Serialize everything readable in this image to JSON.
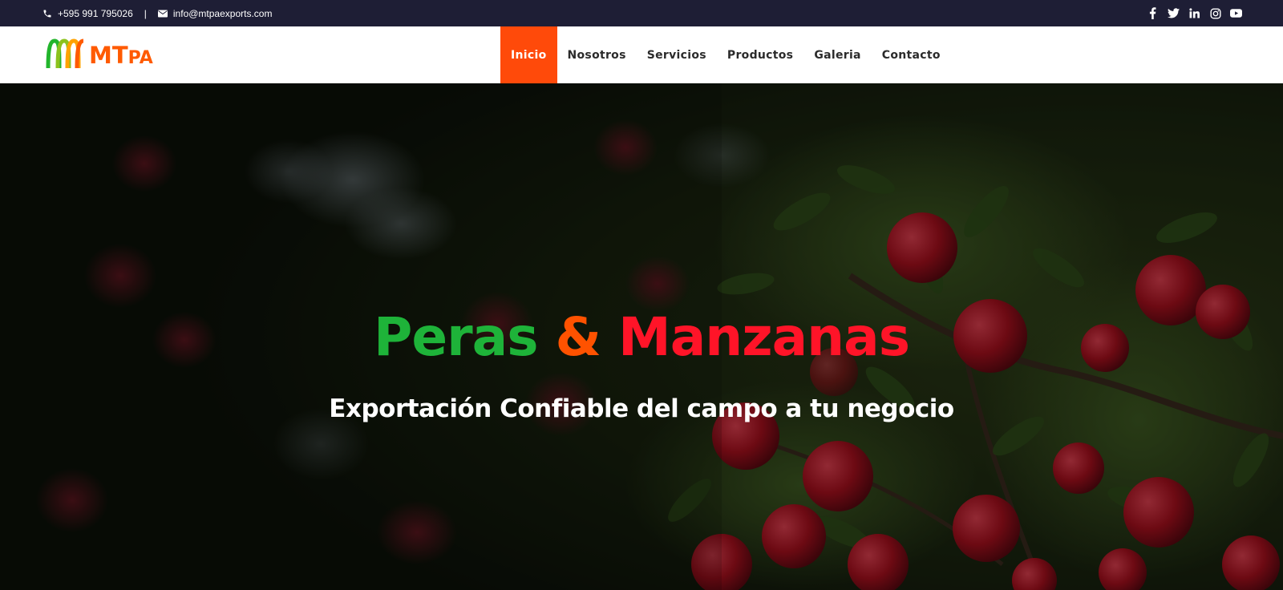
{
  "topbar": {
    "phone": "+595 991 795026",
    "separator": "|",
    "email": "info@mtpaexports.com",
    "social": [
      "facebook-icon",
      "twitter-icon",
      "linkedin-icon",
      "instagram-icon",
      "youtube-icon"
    ]
  },
  "logo": {
    "main": "MT",
    "small": "PA"
  },
  "nav": {
    "items": [
      {
        "label": "Inicio",
        "active": true
      },
      {
        "label": "Nosotros"
      },
      {
        "label": "Servicios"
      },
      {
        "label": "Productos"
      },
      {
        "label": "Galeria"
      },
      {
        "label": "Contacto"
      }
    ]
  },
  "hero": {
    "title_word1": "Peras",
    "title_amp": "&",
    "title_word2": "Manzanas",
    "subtitle": "Exportación Confiable del campo a tu negocio"
  },
  "colors": {
    "topbar_bg": "#1e1e35",
    "accent": "#ff4a0a",
    "green": "#1eb339",
    "red": "#ff1428"
  }
}
